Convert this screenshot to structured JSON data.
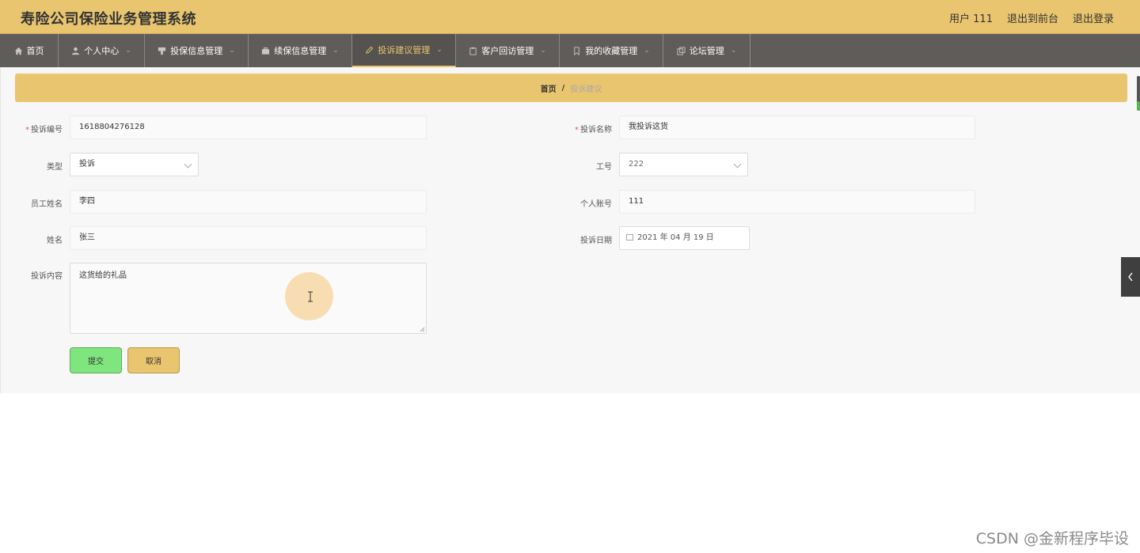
{
  "header": {
    "title": "寿险公司保险业务管理系统",
    "user_label": "用户 111",
    "to_front_label": "退出到前台",
    "logout_label": "退出登录",
    "bg_color": "#e8c56e"
  },
  "nav": {
    "items": [
      {
        "label": "首页",
        "icon": "home-icon",
        "has_caret": false
      },
      {
        "label": "个人中心",
        "icon": "user-icon",
        "has_caret": true
      },
      {
        "label": "投保信息管理",
        "icon": "document-icon",
        "has_caret": true
      },
      {
        "label": "续保信息管理",
        "icon": "briefcase-icon",
        "has_caret": true
      },
      {
        "label": "投诉建议管理",
        "icon": "edit-icon",
        "has_caret": true,
        "active": true
      },
      {
        "label": "客户回访管理",
        "icon": "clipboard-icon",
        "has_caret": true
      },
      {
        "label": "我的收藏管理",
        "icon": "bookmark-icon",
        "has_caret": true
      },
      {
        "label": "论坛管理",
        "icon": "copy-icon",
        "has_caret": true
      }
    ],
    "bg_color": "#5f5d5a",
    "active_color": "#e8c56e"
  },
  "breadcrumb": {
    "home": "首页",
    "separator": "/",
    "current": "投诉建议"
  },
  "form": {
    "complaint_no": {
      "label": "投诉编号",
      "required": true,
      "value": "1618804276128"
    },
    "complaint_name": {
      "label": "投诉名称",
      "required": true,
      "value": "我投诉这货"
    },
    "type": {
      "label": "类型",
      "value": "投诉"
    },
    "employee_no": {
      "label": "工号",
      "value": "222"
    },
    "employee_name": {
      "label": "员工姓名",
      "value": "李四"
    },
    "account": {
      "label": "个人账号",
      "value": "111"
    },
    "name": {
      "label": "姓名",
      "value": "张三"
    },
    "complaint_date": {
      "label": "投诉日期",
      "value": "2021 年 04 月 19 日"
    },
    "content": {
      "label": "投诉内容",
      "value": "这货给的礼品"
    }
  },
  "buttons": {
    "submit": "提交",
    "cancel": "取消"
  },
  "watermark": "CSDN @金新程序毕设"
}
